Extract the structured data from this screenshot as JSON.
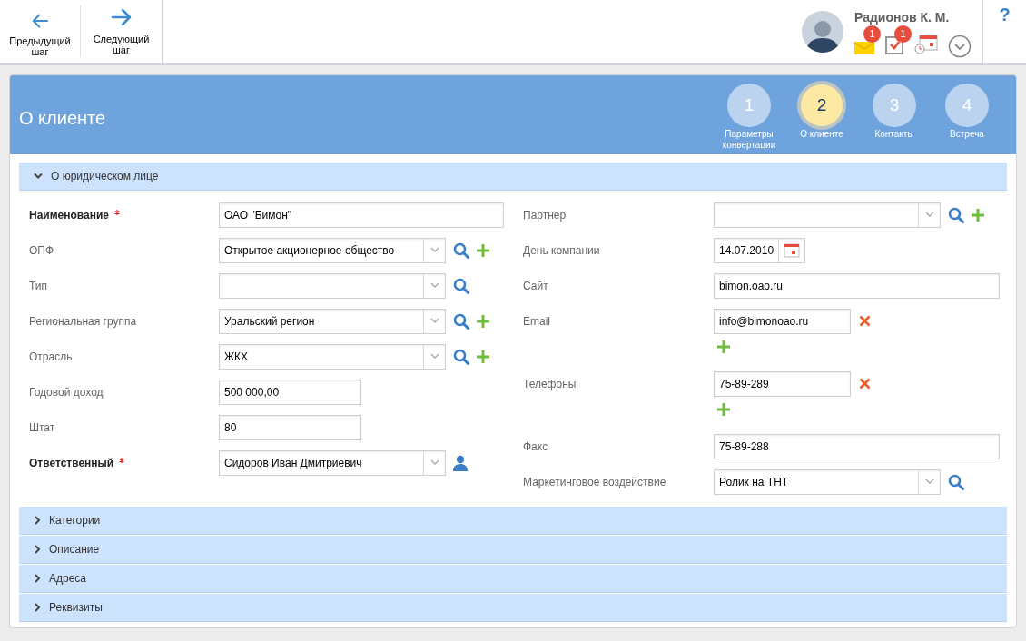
{
  "toolbar": {
    "buttons": [
      {
        "kind": "back",
        "label": "Предыдущий шаг"
      },
      {
        "kind": "next",
        "label": "Следующий шаг"
      }
    ]
  },
  "user": {
    "name": "Радионов К. М.",
    "notifications": [
      {
        "kind": "mail",
        "badge": "1"
      },
      {
        "kind": "tasks",
        "badge": "1"
      },
      {
        "kind": "calendar"
      }
    ]
  },
  "help": "?",
  "page": {
    "title": "О клиенте",
    "steps": [
      {
        "number": "1",
        "label": "Параметры конвертации",
        "selected": false
      },
      {
        "number": "2",
        "label": "О клиенте",
        "selected": true
      },
      {
        "number": "3",
        "label": "Контакты",
        "selected": false
      },
      {
        "number": "4",
        "label": "Встреча",
        "selected": false
      }
    ]
  },
  "sections": [
    {
      "title": "О юридическом лице",
      "expanded": true,
      "left": [
        {
          "kind": "text",
          "label": "Наименование",
          "required": true,
          "value": "ОАО \"Бимон\""
        },
        {
          "kind": "select",
          "label": "ОПФ",
          "value": "Открытое акционерное общество",
          "search": true,
          "add": true
        },
        {
          "kind": "select",
          "label": "Тип",
          "search": true
        },
        {
          "kind": "select",
          "label": "Региональная группа",
          "value": "Уральский регион",
          "search": true,
          "add": true
        },
        {
          "kind": "select",
          "label": "Отрасль",
          "value": "ЖКХ",
          "search": true,
          "add": true
        },
        {
          "kind": "short",
          "label": "Годовой доход",
          "value": "500 000,00"
        },
        {
          "kind": "short",
          "label": "Штат",
          "value": "80"
        },
        {
          "kind": "select",
          "label": "Ответственный",
          "required": true,
          "value": "Сидоров Иван Дмитриевич",
          "pick_user": true
        }
      ],
      "right": [
        {
          "kind": "select",
          "label": "Партнер",
          "search": true,
          "add": true
        },
        {
          "kind": "date",
          "label": "День компании",
          "value": "14.07.2010"
        },
        {
          "kind": "text",
          "label": "Сайт",
          "value": "bimon.oao.ru"
        },
        {
          "kind": "multi",
          "label": "Email",
          "values": [
            "info@bimonoao.ru"
          ]
        },
        {
          "kind": "multi",
          "label": "Телефоны",
          "values": [
            "75-89-289"
          ]
        },
        {
          "kind": "text",
          "label": "Факс",
          "value": "75-89-288"
        },
        {
          "kind": "select",
          "label": "Маркетинговое воздействие",
          "value": "Ролик на ТНТ",
          "search": true
        }
      ]
    },
    {
      "title": "Категории",
      "expanded": false
    },
    {
      "title": "Описание",
      "expanded": false
    },
    {
      "title": "Адреса",
      "expanded": false
    },
    {
      "title": "Реквизиты",
      "expanded": false
    }
  ]
}
